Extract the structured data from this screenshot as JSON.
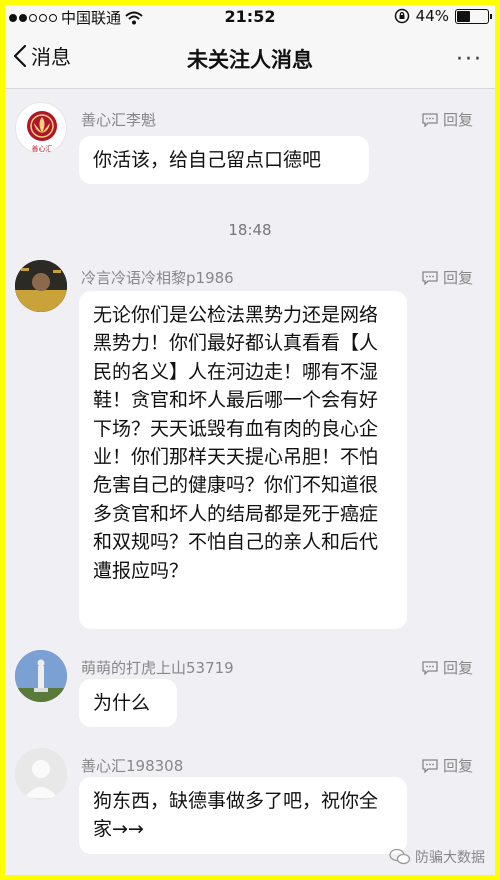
{
  "status_bar": {
    "carrier": "中国联通",
    "time": "21:52",
    "battery": "44%",
    "battery_level": 0.44,
    "signal_bars": 2
  },
  "nav": {
    "back_label": "消息",
    "title": "未关注人消息",
    "more": "···"
  },
  "messages": [
    {
      "sender": "善心汇李魁",
      "reply": "回复",
      "text": "你活该，给自己留点口德吧"
    },
    {
      "sender": "冷言冷语冷相黎p1986",
      "reply": "回复",
      "text": "无论你们是公检法黑势力还是网络黑势力！你们最好都认真看看【人民的名义】人在河边走！哪有不湿鞋！贪官和坏人最后哪一个会有好下场？天天诋毁有血有肉的良心企业！你们那样天天提心吊胆！不怕危害自己的健康吗？你们不知道很多贪官和坏人的结局都是死于癌症和双规吗？不怕自己的亲人和后代遭报应吗？"
    },
    {
      "sender": "萌萌的打虎上山53719",
      "reply": "回复",
      "text": "为什么"
    },
    {
      "sender": "善心汇198308",
      "reply": "回复",
      "text": "狗东西，缺德事做多了吧，祝你全家→→"
    }
  ],
  "timestamp": "18:48",
  "watermark": "防骗大数据",
  "avatar_logo_text": "善心汇"
}
